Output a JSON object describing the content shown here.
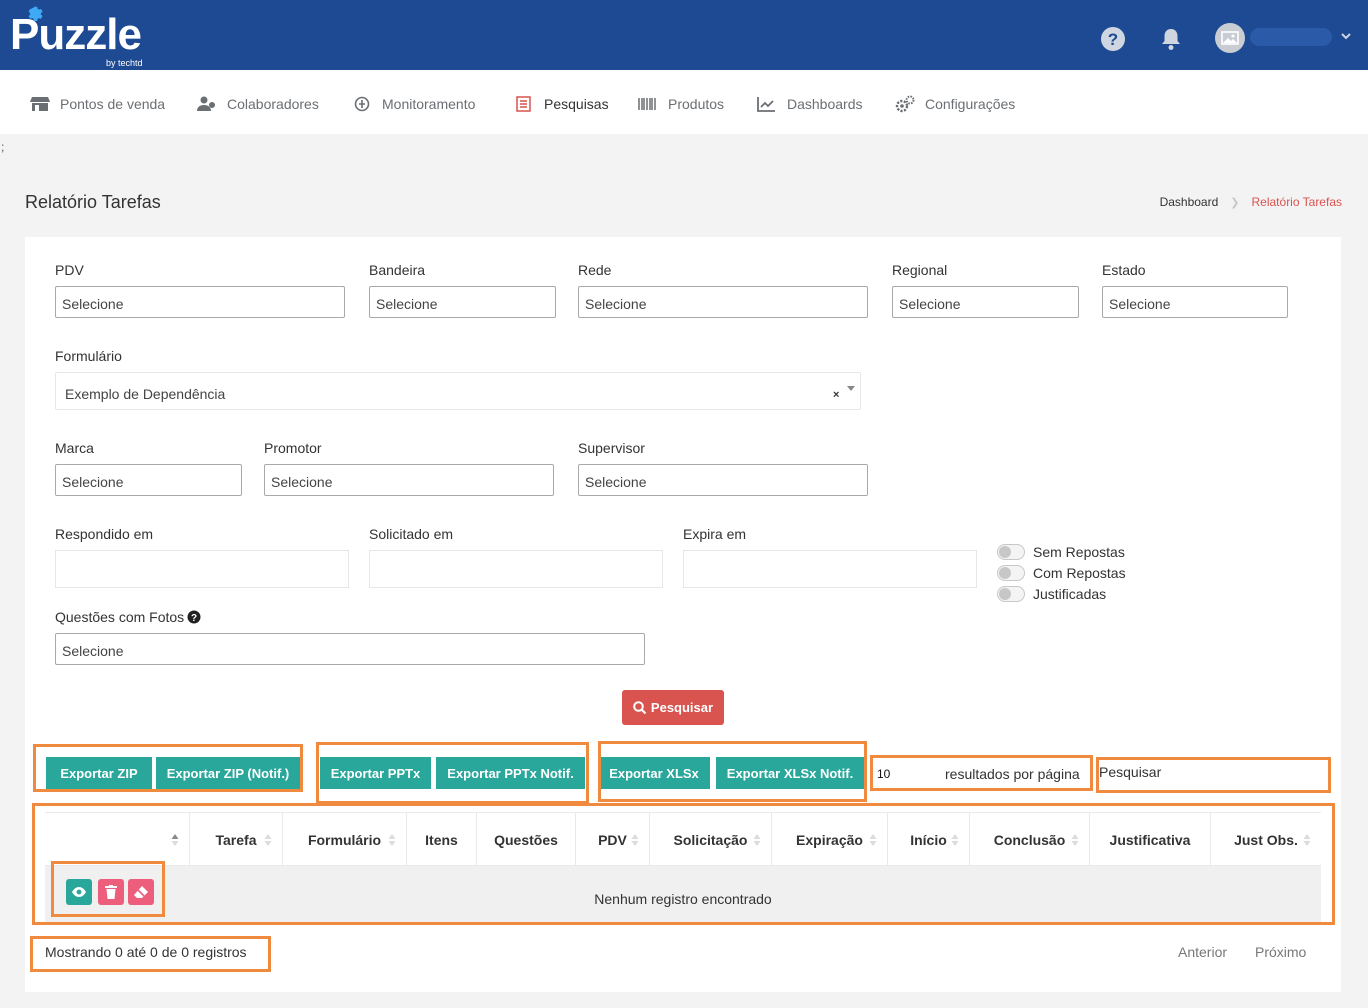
{
  "header": {
    "logo_text": "Puzzle",
    "logo_by": "by techtd"
  },
  "nav": {
    "items": [
      {
        "label": "Pontos de venda",
        "icon": "store-icon"
      },
      {
        "label": "Colaboradores",
        "icon": "users-icon"
      },
      {
        "label": "Monitoramento",
        "icon": "hand-pointer-icon"
      },
      {
        "label": "Pesquisas",
        "icon": "list-icon",
        "active": true
      },
      {
        "label": "Produtos",
        "icon": "barcode-icon"
      },
      {
        "label": "Dashboards",
        "icon": "line-chart-icon"
      },
      {
        "label": "Configurações",
        "icon": "cogs-icon"
      }
    ]
  },
  "stray_text": ";",
  "page": {
    "title": "Relatório Tarefas",
    "breadcrumb_home": "Dashboard",
    "breadcrumb_current": "Relatório Tarefas"
  },
  "filters": {
    "pdv": {
      "label": "PDV",
      "value": "Selecione"
    },
    "bandeira": {
      "label": "Bandeira",
      "value": "Selecione"
    },
    "rede": {
      "label": "Rede",
      "value": "Selecione"
    },
    "regional": {
      "label": "Regional",
      "value": "Selecione"
    },
    "estado": {
      "label": "Estado",
      "value": "Selecione"
    },
    "formulario": {
      "label": "Formulário",
      "value": "Exemplo de Dependência",
      "clear": "×"
    },
    "marca": {
      "label": "Marca",
      "value": "Selecione"
    },
    "promotor": {
      "label": "Promotor",
      "value": "Selecione"
    },
    "supervisor": {
      "label": "Supervisor",
      "value": "Selecione"
    },
    "respondido_em": {
      "label": "Respondido em",
      "value": ""
    },
    "solicitado_em": {
      "label": "Solicitado em",
      "value": ""
    },
    "expira_em": {
      "label": "Expira em",
      "value": ""
    },
    "questoes_fotos": {
      "label": "Questões com Fotos",
      "value": "Selecione"
    },
    "toggles": [
      {
        "label": "Sem Repostas",
        "on": false
      },
      {
        "label": "Com Repostas",
        "on": false
      },
      {
        "label": "Justificadas",
        "on": false
      }
    ]
  },
  "actions": {
    "search_label": "Pesquisar",
    "export_zip": "Exportar ZIP",
    "export_zip_notif": "Exportar ZIP (Notif.)",
    "export_pptx": "Exportar PPTx",
    "export_pptx_notif": "Exportar PPTx Notif.",
    "export_xlsx": "Exportar XLSx",
    "export_xlsx_notif": "Exportar XLSx Notif."
  },
  "table_controls": {
    "per_page": "10",
    "per_page_label": "resultados por página",
    "filter_placeholder": "Pesquisar"
  },
  "table": {
    "columns": [
      "",
      "Tarefa",
      "Formulário",
      "Itens",
      "Questões",
      "PDV",
      "Solicitação",
      "Expiração",
      "Início",
      "Conclusão",
      "Justificativa",
      "Just Obs."
    ],
    "empty_message": "Nenhum registro encontrado"
  },
  "footer": {
    "showing": "Mostrando 0 até 0 de 0 registros",
    "prev": "Anterior",
    "next": "Próximo"
  },
  "colors": {
    "header_bg": "#1d4a92",
    "accent_red": "#d9534f",
    "teal": "#2aa79b",
    "annotation_orange": "#f08a3e",
    "delete_pink": "#ec5e7b"
  }
}
